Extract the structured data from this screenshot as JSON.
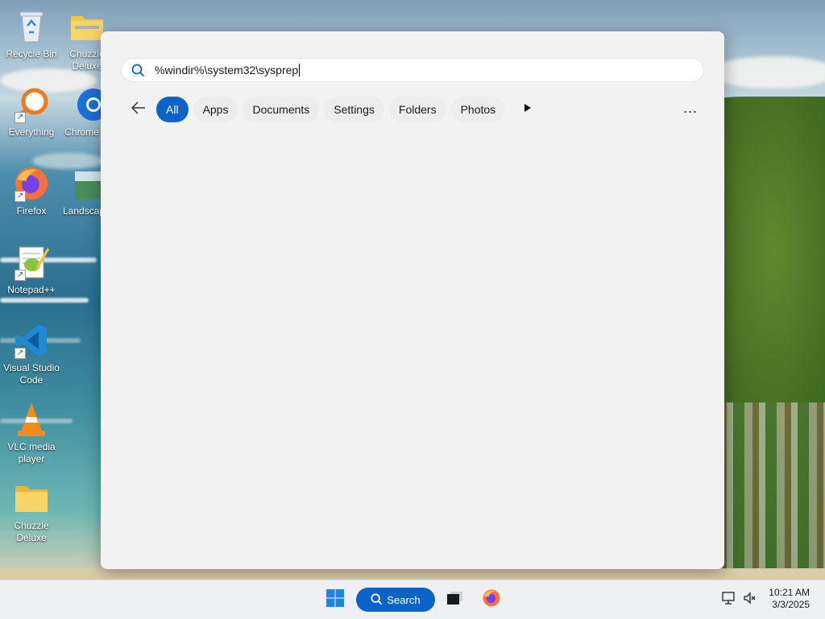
{
  "desktop": {
    "icons": [
      {
        "label": "Recycle Bin",
        "icon": "recycle-bin-icon"
      },
      {
        "label": "Chuzzle Deluxe",
        "icon": "folder-zip-icon"
      },
      {
        "label": "Everything",
        "icon": "everything-search-icon"
      },
      {
        "label": "Chrome",
        "icon": "chrome-icon"
      },
      {
        "label": "Firefox",
        "icon": "firefox-icon"
      },
      {
        "label": "Landscape",
        "icon": "image-icon"
      },
      {
        "label": "Notepad++",
        "icon": "notepadpp-icon"
      },
      {
        "label": "Visual Studio Code",
        "icon": "vscode-icon"
      },
      {
        "label": "VLC media player",
        "icon": "vlc-icon"
      },
      {
        "label": "Chuzzle Deluxe",
        "icon": "folder-icon"
      }
    ]
  },
  "search": {
    "query": "%windir%\\system32\\sysprep",
    "filters": [
      "All",
      "Apps",
      "Documents",
      "Settings",
      "Folders",
      "Photos"
    ],
    "active_filter": "All",
    "more_label": "..."
  },
  "taskbar": {
    "search_label": "Search",
    "time": "10:21 AM",
    "date": "3/3/2025"
  },
  "colors": {
    "accent": "#0a64c8",
    "flyout_bg": "#f2f2f2",
    "taskbar_bg": "#eef0f3"
  }
}
